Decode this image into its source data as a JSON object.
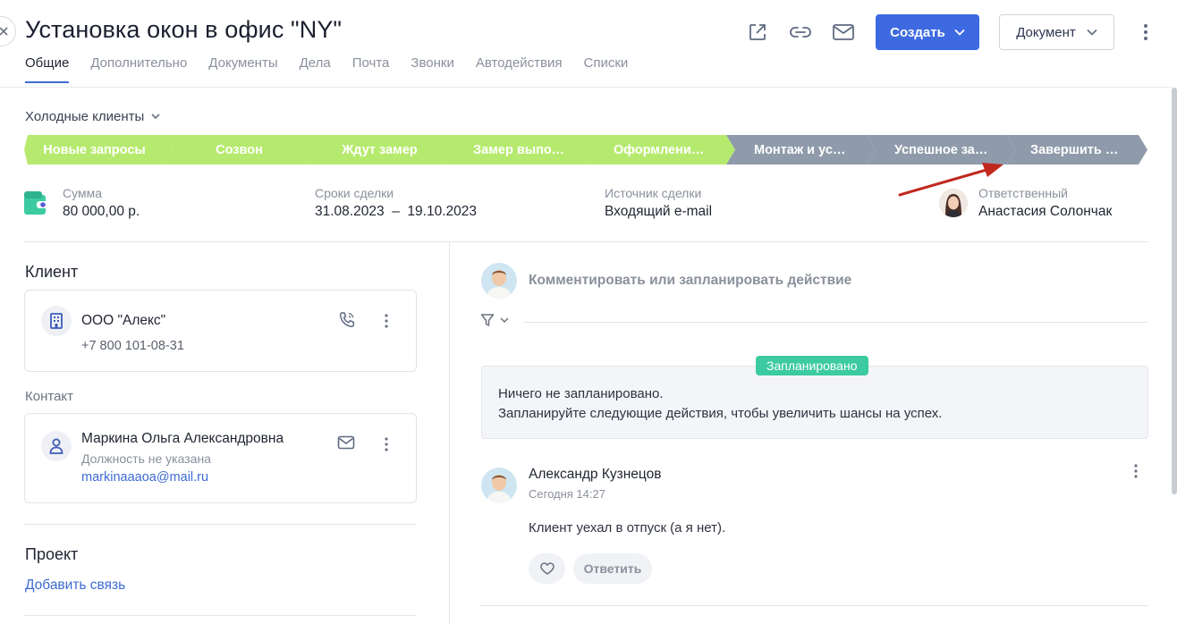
{
  "header": {
    "title": "Установка окон в офис \"NY\"",
    "create_label": "Создать",
    "document_label": "Документ"
  },
  "tabs": [
    {
      "label": "Общие",
      "active": true
    },
    {
      "label": "Дополнительно"
    },
    {
      "label": "Документы"
    },
    {
      "label": "Дела"
    },
    {
      "label": "Почта"
    },
    {
      "label": "Звонки"
    },
    {
      "label": "Автодействия"
    },
    {
      "label": "Списки"
    }
  ],
  "funnel": {
    "label": "Холодные клиенты"
  },
  "stages": [
    {
      "label": "Новые запросы",
      "color": "#b6ea6e"
    },
    {
      "label": "Созвон",
      "color": "#b6ea6e"
    },
    {
      "label": "Ждут замер",
      "color": "#b6ea6e"
    },
    {
      "label": "Замер выполнено",
      "color": "#b6ea6e"
    },
    {
      "label": "Оформление документов",
      "color": "#b6ea6e"
    },
    {
      "label": "Монтаж и установка",
      "color": "#8f9bab"
    },
    {
      "label": "Успешное завершение",
      "color": "#8f9bab"
    },
    {
      "label": "Завершить сделку",
      "color": "#8f9bab"
    }
  ],
  "deal_info": {
    "sum_label": "Сумма",
    "sum_value": "80 000,00 р.",
    "dates_label": "Сроки сделки",
    "dates_value": "31.08.2023  –  19.10.2023",
    "source_label": "Источник сделки",
    "source_value": "Входящий e-mail",
    "owner_label": "Ответственный",
    "owner_value": "Анастасия Солончак"
  },
  "client": {
    "section_title": "Клиент",
    "company": "ООО \"Алекс\"",
    "phone": "+7 800 101-08-31"
  },
  "contact": {
    "section_title": "Контакт",
    "name": "Маркина Ольга Александровна",
    "position": "Должность не указана",
    "email": "markinaaaoa@mail.ru"
  },
  "project": {
    "section_title": "Проект",
    "add_link": "Добавить связь"
  },
  "feed": {
    "comment_placeholder": "Комментировать или запланировать действие",
    "planned_badge": "Запланировано",
    "planned_line1": "Ничего не запланировано.",
    "planned_line2": "Запланируйте следующие действия, чтобы увеличить шансы на успех.",
    "post": {
      "author": "Александр Кузнецов",
      "time": "Сегодня 14:27",
      "text": "Клиент уехал в отпуск (а я нет).",
      "reply_label": "Ответить"
    }
  },
  "colors": {
    "accent": "#3d6ae0",
    "stage_done": "#b6ea6e",
    "stage_pending": "#8f9bab",
    "badge": "#3ccaa0",
    "annotation_arrow": "#c0281e"
  }
}
